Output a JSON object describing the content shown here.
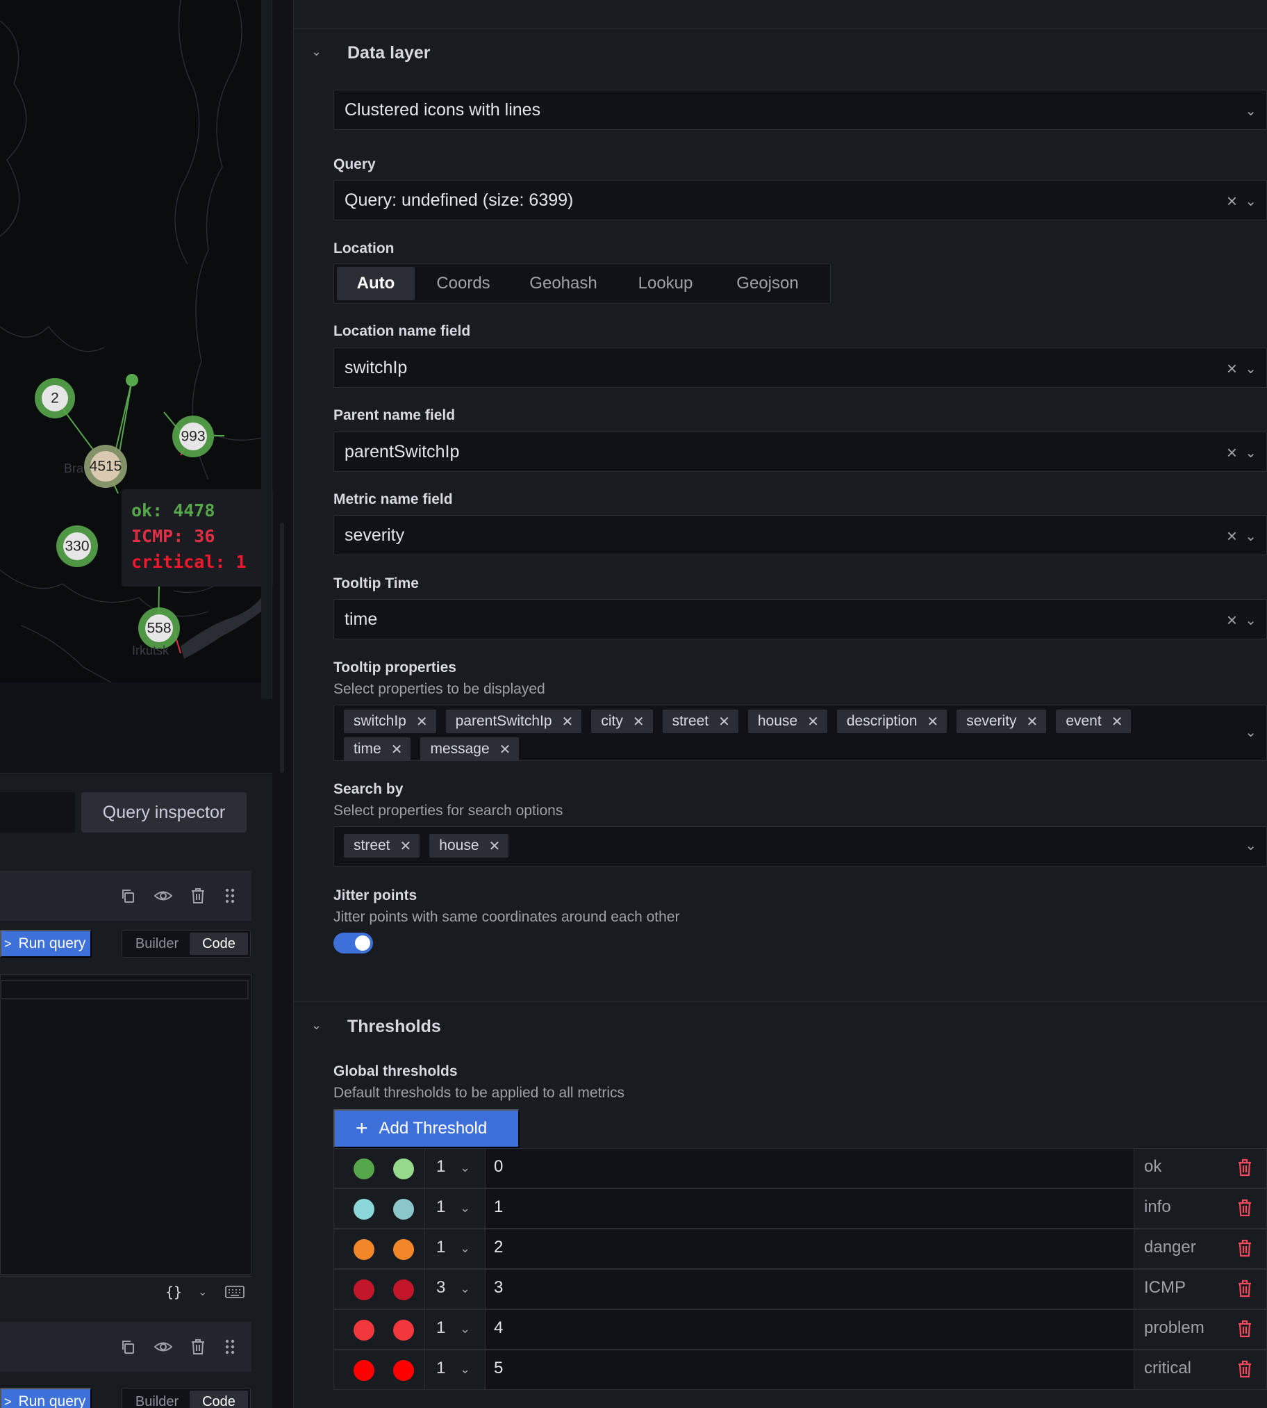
{
  "map": {
    "clusters": [
      "2",
      "4515",
      "993",
      "330",
      "558"
    ],
    "cities": [
      "Bra",
      "Irkutsk"
    ],
    "tooltip": {
      "ok": "ok: 4478",
      "icmp": "ICMP: 36",
      "critical": "critical: 1"
    }
  },
  "left_panel": {
    "query_inspector": "Query inspector",
    "queries": [
      {
        "run_label": "Run query",
        "builder_label": "Builder",
        "code_label": "Code"
      },
      {
        "run_label": "Run query",
        "builder_label": "Builder",
        "code_label": "Code"
      }
    ],
    "editor_footer_braces": "{}"
  },
  "data_layer": {
    "section_title": "Data layer",
    "layer_type": "Clustered icons with lines",
    "query": {
      "label": "Query",
      "value": "Query: undefined (size: 6399)"
    },
    "location": {
      "label": "Location",
      "options": [
        "Auto",
        "Coords",
        "Geohash",
        "Lookup",
        "Geojson"
      ],
      "selected": "Auto"
    },
    "location_name_field": {
      "label": "Location name field",
      "value": "switchIp"
    },
    "parent_name_field": {
      "label": "Parent name field",
      "value": "parentSwitchIp"
    },
    "metric_name_field": {
      "label": "Metric name field",
      "value": "severity"
    },
    "tooltip_time": {
      "label": "Tooltip Time",
      "value": "time"
    },
    "tooltip_properties": {
      "label": "Tooltip properties",
      "description": "Select properties to be displayed",
      "tags": [
        "switchIp",
        "parentSwitchIp",
        "city",
        "street",
        "house",
        "description",
        "severity",
        "event",
        "time",
        "message"
      ]
    },
    "search_by": {
      "label": "Search by",
      "description": "Select properties for search options",
      "tags": [
        "street",
        "house"
      ]
    },
    "jitter_points": {
      "label": "Jitter points",
      "description": "Jitter points with same coordinates around each other",
      "enabled": true
    }
  },
  "thresholds": {
    "section_title": "Thresholds",
    "global_label": "Global thresholds",
    "global_description": "Default thresholds to be applied to all metrics",
    "add_button": "Add Threshold",
    "rows": [
      {
        "color1": "#56a64b",
        "color2": "#96d98d",
        "width": "1",
        "value": "0",
        "label": "ok"
      },
      {
        "color1": "#8ad6d8",
        "color2": "#8ac6ca",
        "width": "1",
        "value": "1",
        "label": "info"
      },
      {
        "color1": "#f2872a",
        "color2": "#f2872a",
        "width": "1",
        "value": "2",
        "label": "danger"
      },
      {
        "color1": "#c4162a",
        "color2": "#c4162a",
        "width": "3",
        "value": "3",
        "label": "ICMP"
      },
      {
        "color1": "#f2383c",
        "color2": "#f2383c",
        "width": "1",
        "value": "4",
        "label": "problem"
      },
      {
        "color1": "#ff0000",
        "color2": "#ff0000",
        "width": "1",
        "value": "5",
        "label": "critical"
      }
    ]
  },
  "colors": {
    "accent": "#3d71d9",
    "delete_icon": "#f2495c",
    "panel_bg": "#181b1f",
    "input_bg": "#111217"
  },
  "icons": [
    "chevron-down-icon",
    "close-icon",
    "copy-icon",
    "eye-icon",
    "trash-icon",
    "drag-icon",
    "keyboard-icon",
    "plus-icon"
  ]
}
